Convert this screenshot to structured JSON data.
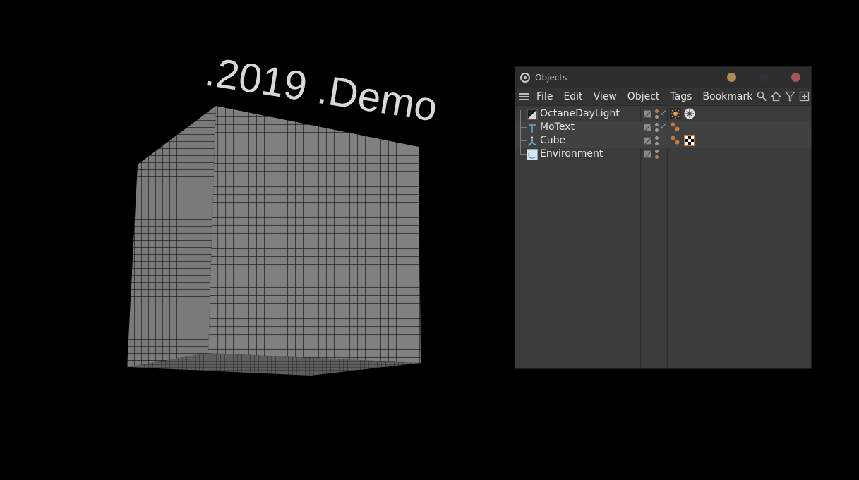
{
  "viewport": {
    "text3d": ".2019 .Demo"
  },
  "window": {
    "title": "Objects",
    "menu": [
      "File",
      "Edit",
      "View",
      "Object",
      "Tags",
      "Bookmark"
    ],
    "objects": [
      {
        "name": "OctaneDayLight",
        "icon": "daylight-icon",
        "editor_dot": "orange",
        "render_dot": "grey",
        "enabled": true,
        "tags": [
          "octane-daylight-tag-icon",
          "snowflake-tag-icon"
        ]
      },
      {
        "name": "MoText",
        "icon": "motext-icon",
        "editor_dot": "grey",
        "render_dot": "grey",
        "enabled": true,
        "tags": [
          "phong-tag-icon"
        ]
      },
      {
        "name": "Cube",
        "icon": "cube-icon",
        "editor_dot": "grey",
        "render_dot": "grey",
        "enabled": false,
        "tags": [
          "phong-tag-icon",
          "material-tag-icon"
        ]
      },
      {
        "name": "Environment",
        "icon": "environment-icon",
        "editor_dot": "grey",
        "render_dot": "orange",
        "enabled": false,
        "tags": []
      }
    ]
  },
  "colors": {
    "cube_face": "#7c7c7c",
    "cube_lines": "#111111",
    "text": "#d8d8d8",
    "panel_bg": "#3b3b3b",
    "accent_orange": "#c87a3c"
  }
}
